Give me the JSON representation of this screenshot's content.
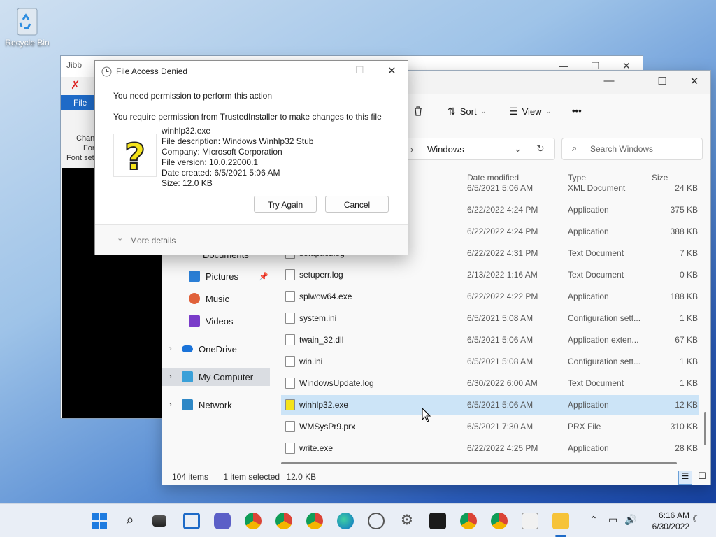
{
  "desktop": {
    "recycle_bin_label": "Recycle Bin"
  },
  "bg_window": {
    "title_fragment": "Jibb",
    "file_tab": "File",
    "fragment1": "Chan",
    "fragment2": "Fon",
    "fragment3": "Font set"
  },
  "explorer": {
    "toolbar": {
      "sort": "Sort",
      "view": "View",
      "more": "•••"
    },
    "address": {
      "path": "Windows"
    },
    "search": {
      "placeholder": "Search Windows"
    },
    "nav": [
      {
        "label": "Documents"
      },
      {
        "label": "Pictures"
      },
      {
        "label": "Music"
      },
      {
        "label": "Videos"
      },
      {
        "label": "OneDrive"
      },
      {
        "label": "My Computer"
      },
      {
        "label": "Network"
      }
    ],
    "columns": {
      "date": "Date modified",
      "type": "Type",
      "size": "Size"
    },
    "rows": [
      {
        "name": "",
        "date": "6/5/2021 5:06 AM",
        "type": "XML Document",
        "size": "24 KB"
      },
      {
        "name": "",
        "date": "6/22/2022 4:24 PM",
        "type": "Application",
        "size": "375 KB"
      },
      {
        "name": "",
        "date": "6/22/2022 4:24 PM",
        "type": "Application",
        "size": "388 KB"
      },
      {
        "name": "setupact.log",
        "date": "6/22/2022 4:31 PM",
        "type": "Text Document",
        "size": "7 KB"
      },
      {
        "name": "setuperr.log",
        "date": "2/13/2022 1:16 AM",
        "type": "Text Document",
        "size": "0 KB"
      },
      {
        "name": "splwow64.exe",
        "date": "6/22/2022 4:22 PM",
        "type": "Application",
        "size": "188 KB"
      },
      {
        "name": "system.ini",
        "date": "6/5/2021 5:08 AM",
        "type": "Configuration sett...",
        "size": "1 KB"
      },
      {
        "name": "twain_32.dll",
        "date": "6/5/2021 5:06 AM",
        "type": "Application exten...",
        "size": "67 KB"
      },
      {
        "name": "win.ini",
        "date": "6/5/2021 5:08 AM",
        "type": "Configuration sett...",
        "size": "1 KB"
      },
      {
        "name": "WindowsUpdate.log",
        "date": "6/30/2022 6:00 AM",
        "type": "Text Document",
        "size": "1 KB"
      },
      {
        "name": "winhlp32.exe",
        "date": "6/5/2021 5:06 AM",
        "type": "Application",
        "size": "12 KB"
      },
      {
        "name": "WMSysPr9.prx",
        "date": "6/5/2021 7:30 AM",
        "type": "PRX File",
        "size": "310 KB"
      },
      {
        "name": "write.exe",
        "date": "6/22/2022 4:25 PM",
        "type": "Application",
        "size": "28 KB"
      }
    ],
    "status": {
      "items": "104 items",
      "selected": "1 item selected",
      "size": "12.0 KB"
    }
  },
  "dialog": {
    "title": "File Access Denied",
    "heading": "You need permission to perform this action",
    "message": "You require permission from TrustedInstaller to make changes to this file",
    "file_name": "winhlp32.exe",
    "file_description": "File description: Windows Winhlp32 Stub",
    "company": "Company: Microsoft Corporation",
    "file_version": "File version: 10.0.22000.1",
    "date_created": "Date created: 6/5/2021 5:06 AM",
    "size": "Size: 12.0 KB",
    "try_again": "Try Again",
    "cancel": "Cancel",
    "more_details": "More details"
  },
  "taskbar": {
    "time": "6:16 AM",
    "date": "6/30/2022"
  },
  "colors": {
    "accent": "#1e6ac7",
    "selection": "#cce4f7",
    "nav_selected": "#dadde2"
  }
}
